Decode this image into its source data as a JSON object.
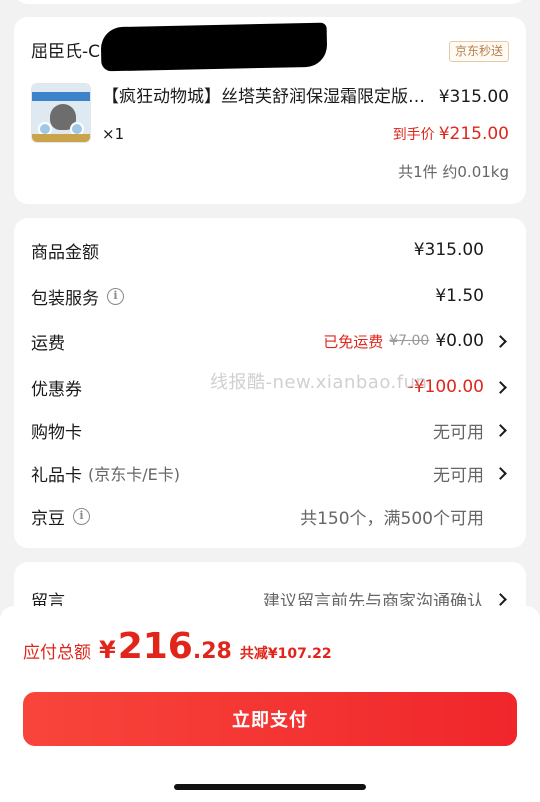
{
  "product_card": {
    "shop_name": "屈臣氏-C",
    "badge": "京东秒送",
    "title": "【疯狂动物城】丝塔芙舒润保湿霜限定版…",
    "quantity": "×1",
    "price_original": "¥315.00",
    "price_final_label": "到手价",
    "price_final": "¥215.00",
    "summary": "共1件 约0.01kg"
  },
  "fees": {
    "goods_amount": {
      "label": "商品金额",
      "value": "¥315.00"
    },
    "packaging": {
      "label": "包装服务",
      "value": "¥1.50"
    },
    "shipping": {
      "label": "运费",
      "free_tag": "已免运费",
      "strike": "¥7.00",
      "value": "¥0.00"
    },
    "coupon": {
      "label": "优惠券",
      "value": "-¥100.00"
    },
    "shopping_card": {
      "label": "购物卡",
      "value": "无可用"
    },
    "gift_card": {
      "label": "礼品卡",
      "sub": "(京东卡/E卡)",
      "value": "无可用"
    },
    "jingdou": {
      "label": "京豆",
      "value": "共150个，满500个可用"
    }
  },
  "note": {
    "label": "留言",
    "placeholder": "建议留言前先与商家沟通确认"
  },
  "watermark": "线报酷-new.xianbao.fun",
  "total": {
    "label": "应付总额",
    "currency": "¥",
    "amount_int": "216",
    "amount_dec": ".28",
    "saved": "共减¥107.22"
  },
  "pay_button": "立即支付",
  "colors": {
    "accent": "#e1251b",
    "badge": "#b7804a"
  }
}
